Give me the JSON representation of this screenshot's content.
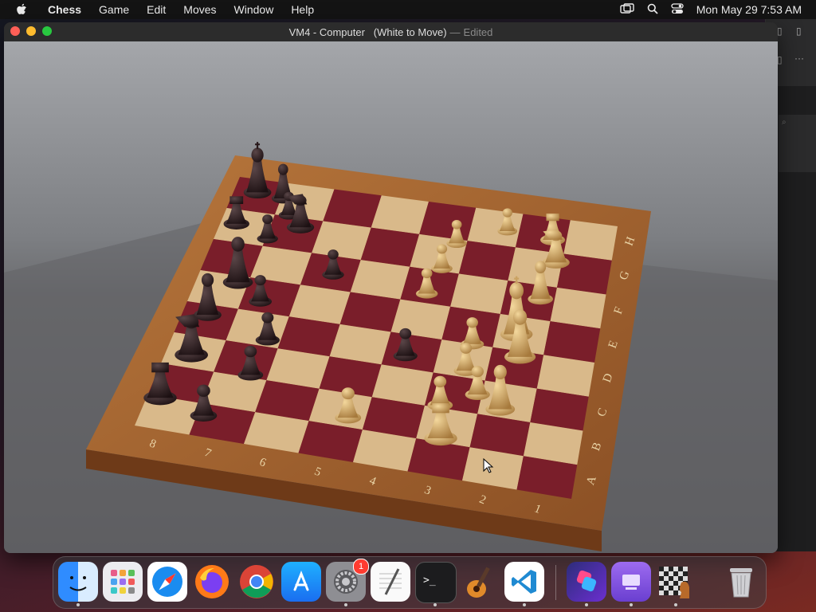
{
  "menubar": {
    "app": "Chess",
    "items": [
      "Game",
      "Edit",
      "Moves",
      "Window",
      "Help"
    ],
    "clock": "Mon May 29  7:53 AM"
  },
  "window": {
    "title": "VM4 - Computer   (White to Move)",
    "separator": "—",
    "edited": "Edited"
  },
  "board": {
    "files": [
      "A",
      "B",
      "C",
      "D",
      "E",
      "F",
      "G",
      "H"
    ],
    "ranks": [
      "1",
      "2",
      "3",
      "4",
      "5",
      "6",
      "7",
      "8"
    ]
  },
  "dock": {
    "apps": [
      "finder-icon",
      "launchpad-icon",
      "safari-icon",
      "firefox-icon",
      "chrome-icon",
      "app-store-icon",
      "system-settings-icon",
      "textedit-icon",
      "terminal-icon",
      "garageband-icon",
      "vscode-icon",
      "shortcuts-icon",
      "simulator-icon",
      "chess-icon",
      "trash-icon"
    ],
    "settings_badge": "1"
  },
  "colors": {
    "dark_square": "#7a1e2a",
    "light_square": "#d9b98a",
    "board_frame": "#9a5a2a",
    "black_piece": "#2a1a1c",
    "white_piece": "#d8b473"
  }
}
